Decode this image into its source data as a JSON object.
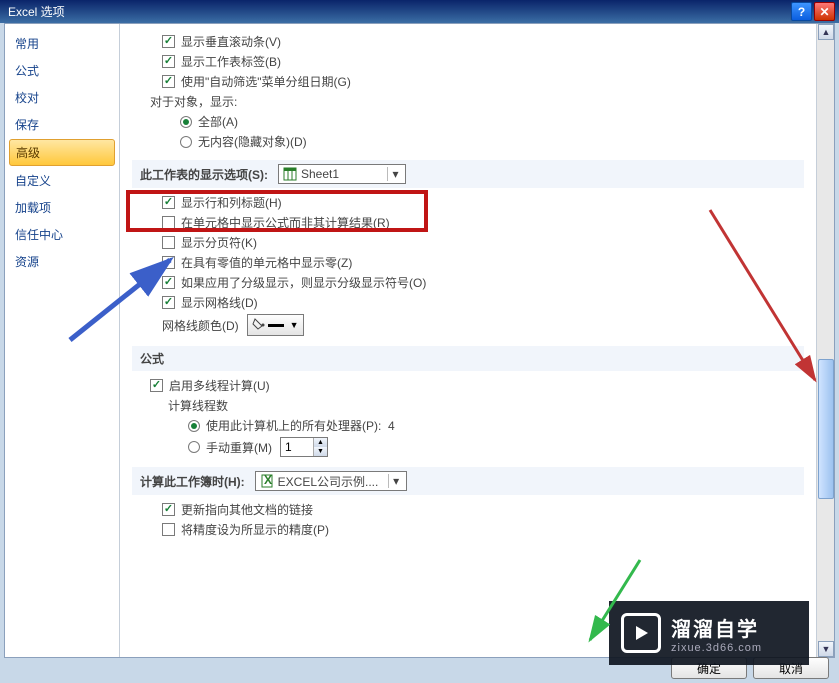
{
  "title": "Excel 选项",
  "sidebar": {
    "items": [
      {
        "label": "常用"
      },
      {
        "label": "公式"
      },
      {
        "label": "校对"
      },
      {
        "label": "保存"
      },
      {
        "label": "高级"
      },
      {
        "label": "自定义"
      },
      {
        "label": "加载项"
      },
      {
        "label": "信任中心"
      },
      {
        "label": "资源"
      }
    ],
    "selected_index": 4
  },
  "options": {
    "show_vertical_scrollbar": {
      "label": "显示垂直滚动条(V)",
      "checked": true
    },
    "show_sheet_tabs": {
      "label": "显示工作表标签(B)",
      "checked": true
    },
    "autofilter_group_dates": {
      "label": "使用\"自动筛选\"菜单分组日期(G)",
      "checked": true
    },
    "objects_label": "对于对象，显示:",
    "objects_all": {
      "label": "全部(A)",
      "checked": true
    },
    "objects_none": {
      "label": "无内容(隐藏对象)(D)",
      "checked": false
    }
  },
  "worksheet_section": {
    "title": "此工作表的显示选项(S):",
    "dropdown_value": "Sheet1",
    "show_row_col_headers": {
      "label": "显示行和列标题(H)",
      "checked": true
    },
    "show_formulas": {
      "label": "在单元格中显示公式而非其计算结果(R)",
      "checked": false
    },
    "show_page_breaks": {
      "label": "显示分页符(K)",
      "checked": false
    },
    "show_zero": {
      "label": "在具有零值的单元格中显示零(Z)",
      "checked": true
    },
    "show_outline": {
      "label": "如果应用了分级显示，则显示分级显示符号(O)",
      "checked": true
    },
    "show_gridlines": {
      "label": "显示网格线(D)",
      "checked": true
    },
    "gridline_color_label": "网格线颜色(D)"
  },
  "formula_section": {
    "title": "公式",
    "multithread": {
      "label": "启用多线程计算(U)",
      "checked": true
    },
    "threads_label": "计算线程数",
    "use_all_cpus": {
      "label": "使用此计算机上的所有处理器(P):",
      "count": "4",
      "checked": true
    },
    "manual": {
      "label": "手动重算(M)",
      "value": "1",
      "checked": false
    }
  },
  "workbook_section": {
    "title": "计算此工作簿时(H):",
    "dropdown_value": "EXCEL公司示例....",
    "update_links": {
      "label": "更新指向其他文档的链接",
      "checked": true
    },
    "precision_as_displayed": {
      "label": "将精度设为所显示的精度(P)",
      "checked": false
    }
  },
  "buttons": {
    "ok": "确定",
    "cancel": "取消"
  },
  "watermark": {
    "brand": "溜溜自学",
    "url": "zixue.3d66.com"
  }
}
